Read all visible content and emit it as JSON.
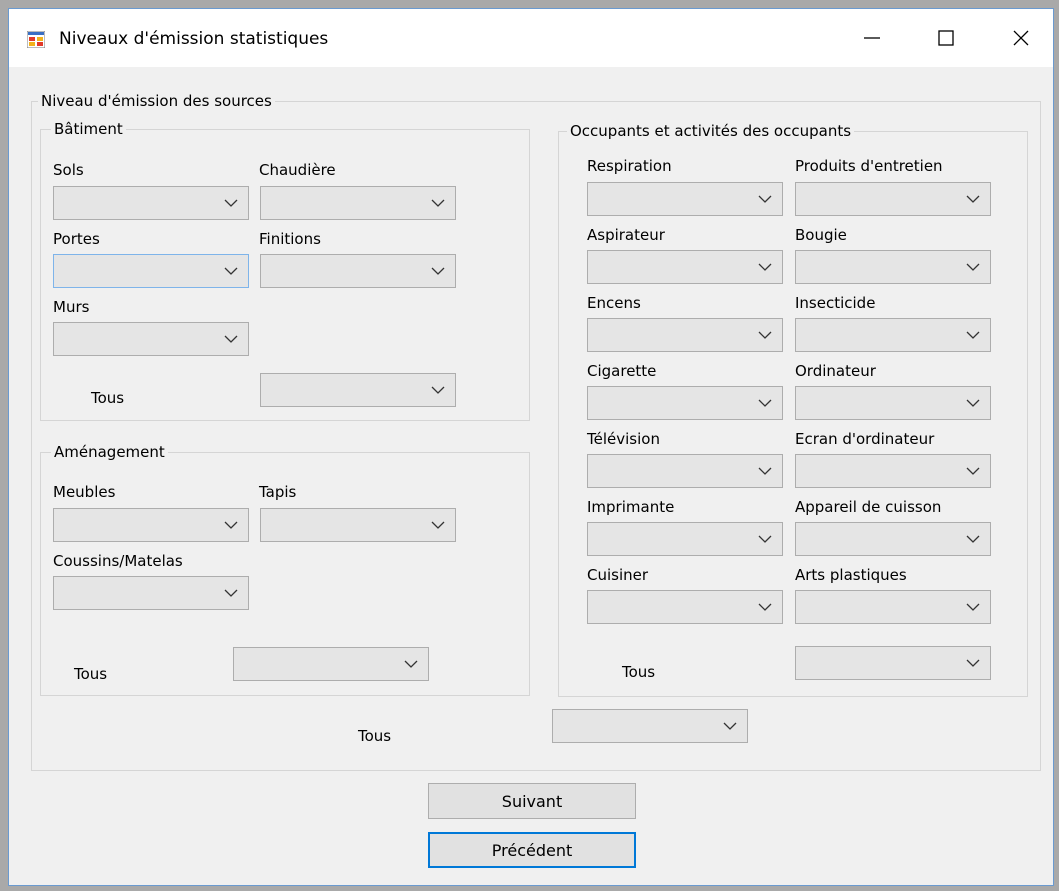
{
  "window": {
    "title": "Niveaux d'émission statistiques"
  },
  "main_group": {
    "label": "Niveau d'émission des sources"
  },
  "batiment": {
    "label": "Bâtiment",
    "sols": "Sols",
    "chaudiere": "Chaudière",
    "portes": "Portes",
    "finitions": "Finitions",
    "murs": "Murs",
    "tous": "Tous"
  },
  "amenagement": {
    "label": "Aménagement",
    "meubles": "Meubles",
    "tapis": "Tapis",
    "coussins": "Coussins/Matelas",
    "tous": "Tous"
  },
  "occupants": {
    "label": "Occupants et activités des occupants",
    "respiration": "Respiration",
    "produits": "Produits d'entretien",
    "aspirateur": "Aspirateur",
    "bougie": "Bougie",
    "encens": "Encens",
    "insecticide": "Insecticide",
    "cigarette": "Cigarette",
    "ordinateur": "Ordinateur",
    "television": "Télévision",
    "ecran": "Ecran d'ordinateur",
    "imprimante": "Imprimante",
    "cuisson": "Appareil de cuisson",
    "cuisiner": "Cuisiner",
    "arts": "Arts plastiques",
    "tous": "Tous"
  },
  "global_tous": "Tous",
  "buttons": {
    "next": "Suivant",
    "previous": "Précédent"
  },
  "icons": {
    "app": "app-window-icon",
    "minimize": "minimize-icon",
    "maximize": "maximize-icon",
    "close": "close-icon",
    "dropdown": "chevron-down-icon"
  }
}
